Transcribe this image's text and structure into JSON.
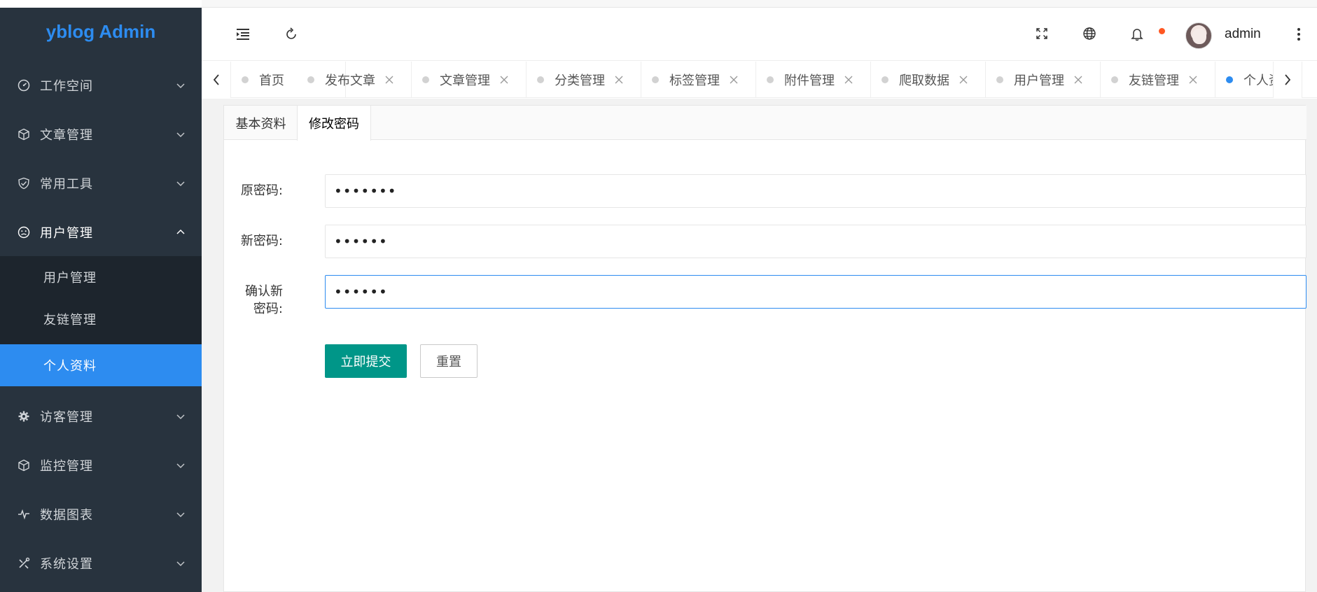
{
  "sidebar": {
    "brand": "yblog Admin",
    "items": [
      {
        "label": "工作空间",
        "icon": "dashboard-icon"
      },
      {
        "label": "文章管理",
        "icon": "cube-icon"
      },
      {
        "label": "常用工具",
        "icon": "shield-icon"
      },
      {
        "label": "用户管理",
        "icon": "face-icon"
      },
      {
        "label": "访客管理",
        "icon": "gear-icon"
      },
      {
        "label": "监控管理",
        "icon": "cube-icon"
      },
      {
        "label": "数据图表",
        "icon": "pulse-icon"
      },
      {
        "label": "系统设置",
        "icon": "tools-icon"
      }
    ],
    "subitems": [
      {
        "label": "用户管理"
      },
      {
        "label": "友链管理"
      },
      {
        "label": "个人资料"
      }
    ]
  },
  "header": {
    "username": "admin",
    "icons": [
      "menu-fold-icon",
      "refresh-icon",
      "fullscreen-icon",
      "globe-icon",
      "bell-icon",
      "more-vertical-icon"
    ]
  },
  "tabs": [
    {
      "label": "首页",
      "closable": false
    },
    {
      "label": "发布文章",
      "closable": true
    },
    {
      "label": "文章管理",
      "closable": true
    },
    {
      "label": "分类管理",
      "closable": true
    },
    {
      "label": "标签管理",
      "closable": true
    },
    {
      "label": "附件管理",
      "closable": true
    },
    {
      "label": "爬取数据",
      "closable": true
    },
    {
      "label": "用户管理",
      "closable": true
    },
    {
      "label": "友链管理",
      "closable": true
    },
    {
      "label": "个人资料",
      "closable": true,
      "active": true
    }
  ],
  "card": {
    "tabs": [
      {
        "label": "基本资料"
      },
      {
        "label": "修改密码"
      }
    ],
    "form": {
      "old_password_label": "原密码:",
      "old_password_value": "•••••••",
      "new_password_label": "新密码:",
      "new_password_value": "••••••",
      "confirm_label_line1": "确认新",
      "confirm_label_line2": "密码:",
      "confirm_value": "••••••",
      "submit_label": "立即提交",
      "reset_label": "重置"
    }
  },
  "colors": {
    "sidebar_bg": "#28333e",
    "submenu_bg": "#1d252d",
    "accent": "#2d8cf0",
    "primary_button": "#009688",
    "notification_dot": "#ff5722"
  }
}
